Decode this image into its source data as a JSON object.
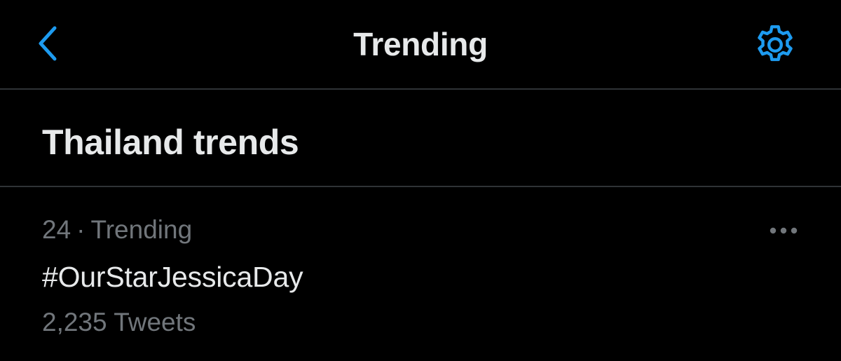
{
  "nav": {
    "title": "Trending",
    "back_icon": "chevron-left-icon",
    "settings_icon": "gear-icon",
    "accent_color": "#1d9bf0"
  },
  "section": {
    "title": "Thailand trends"
  },
  "trends": [
    {
      "rank": "24",
      "separator": "·",
      "context": "Trending",
      "name": "#OurStarJessicaDay",
      "count": "2,235 Tweets",
      "more_icon": "more-horizontal-icon"
    }
  ],
  "colors": {
    "background": "#000000",
    "primary_text": "#e7e9ea",
    "secondary_text": "#71767b",
    "divider": "#2f3336"
  }
}
